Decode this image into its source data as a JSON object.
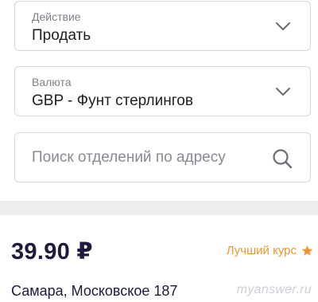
{
  "action": {
    "label": "Действие",
    "value": "Продать"
  },
  "currency": {
    "label": "Валюта",
    "value": "GBP - Фунт стерлингов"
  },
  "search": {
    "placeholder": "Поиск отделений по адресу",
    "icon": "search-icon"
  },
  "offer": {
    "rate": "39.90 ₽",
    "best_rate_label": "Лучший курс",
    "star_icon": "star-icon",
    "branch": "Самара, Московское 187",
    "watermark": "myanswer.ru"
  },
  "colors": {
    "accent_orange": "#f0952e",
    "text_dark": "#1d1a3d",
    "field_border": "#d6d6dc",
    "divider": "#eeeef1"
  }
}
